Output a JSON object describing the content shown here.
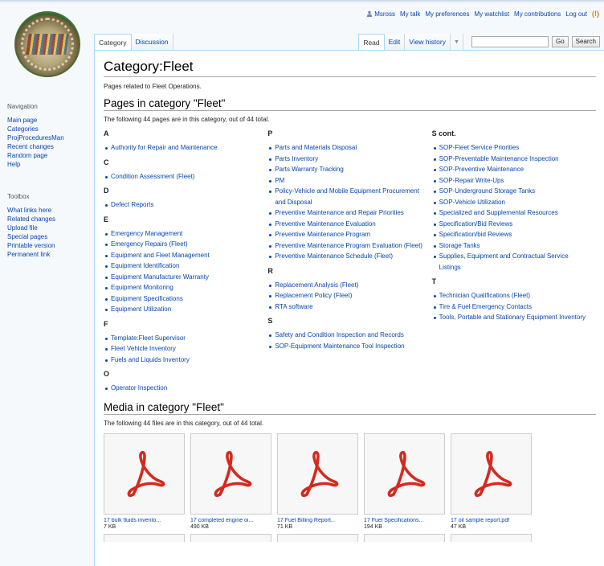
{
  "personal": [
    "Msross",
    "My talk",
    "My preferences",
    "My watchlist",
    "My contributions",
    "Log out"
  ],
  "logo_text": "Public Works Department",
  "nav": {
    "heading": "Navigation",
    "items": [
      "Main page",
      "Categories",
      "ProjProceduresMan",
      "Recent changes",
      "Random page",
      "Help"
    ]
  },
  "toolbox": {
    "heading": "Toolbox",
    "items": [
      "What links here",
      "Related changes",
      "Upload file",
      "Special pages",
      "Printable version",
      "Permanent link"
    ]
  },
  "tabs": {
    "category": "Category",
    "discussion": "Discussion",
    "read": "Read",
    "edit": "Edit",
    "history": "View history"
  },
  "search": {
    "go": "Go",
    "search": "Search",
    "value": ""
  },
  "title": "Category:Fleet",
  "intro": "Pages related to Fleet Operations.",
  "pages_heading": "Pages in category \"Fleet\"",
  "pages_count": "The following 44 pages are in this category, out of 44 total.",
  "groups": [
    [
      {
        "letter": "A",
        "items": [
          "Authority for Repair and Maintenance"
        ]
      },
      {
        "letter": "C",
        "items": [
          "Condition Assessment (Fleet)"
        ]
      },
      {
        "letter": "D",
        "items": [
          "Defect Reports"
        ]
      },
      {
        "letter": "E",
        "items": [
          "Emergency Management",
          "Emergency Repairs (Fleet)",
          "Equipment and Fleet Management",
          "Equipment Identification",
          "Equipment Manufacturer Warranty",
          "Equipment Monitoring",
          "Equipment Specifications",
          "Equipment Utilization"
        ]
      },
      {
        "letter": "F",
        "items": [
          "Template:Fleet Supervisor",
          "Fleet Vehicle Inventory",
          "Fuels and Liquids Inventory"
        ]
      },
      {
        "letter": "O",
        "items": [
          "Operator Inspection"
        ]
      }
    ],
    [
      {
        "letter": "P",
        "items": [
          "Parts and Materials Disposal",
          "Parts Inventory",
          "Parts Warranty Tracking",
          "PM",
          "Policy-Vehicle and Mobile Equipment Procurement and Disposal",
          "Preventive Maintenance and Repair Priorities",
          "Preventive Maintenance Evaluation",
          "Preventive Maintenance Program",
          "Preventive Maintenance Program Evaluation (Fleet)",
          "Preventive Maintenance Schedule (Fleet)"
        ]
      },
      {
        "letter": "R",
        "items": [
          "Replacement Analysis (Fleet)",
          "Replacement Policy (Fleet)",
          "RTA software"
        ]
      },
      {
        "letter": "S",
        "items": [
          "Safety and Condition Inspection and Records",
          "SOP-Equipment Maintenance Tool Inspection"
        ]
      }
    ],
    [
      {
        "letter": "S cont.",
        "items": [
          "SOP-Fleet Service Priorities",
          "SOP-Preventable Maintenance Inspection",
          "SOP-Preventive Maintenance",
          "SOP-Repair Write-Ups",
          "SOP-Underground Storage Tanks",
          "SOP-Vehicle Utilization",
          "Specialized and Supplemental Resources",
          "Specification/Bid Reviews",
          "Specification/bid Reviews",
          "Storage Tanks",
          "Supplies, Equipment and Contractual Service Listings"
        ]
      },
      {
        "letter": "T",
        "items": [
          "Technician Qualifications (Fleet)",
          "Tire & Fuel Emergency Contacts",
          "Tools, Portable and Stationary Equipment Inventory"
        ]
      }
    ]
  ],
  "media_heading": "Media in category \"Fleet\"",
  "media_count": "The following 44 files are in this category, out of 44 total.",
  "media": [
    {
      "name": "17 bulk fluids invento...",
      "size": "7 KB"
    },
    {
      "name": "17 completed engine oi...",
      "size": "490 KB"
    },
    {
      "name": "17 Fuel Billing Report...",
      "size": "71 KB"
    },
    {
      "name": "17 Fuel Specifications...",
      "size": "194 KB"
    },
    {
      "name": "17 oil sample report.pdf",
      "size": "47 KB"
    }
  ],
  "colors": {
    "link": "#0645ad",
    "pdf": "#d42a1e",
    "border": "#a7d7f9"
  },
  "icons": {
    "user": "user-icon",
    "notify": "notification-icon",
    "pdf": "pdf-icon",
    "dropdown": "chevron-down-icon"
  }
}
